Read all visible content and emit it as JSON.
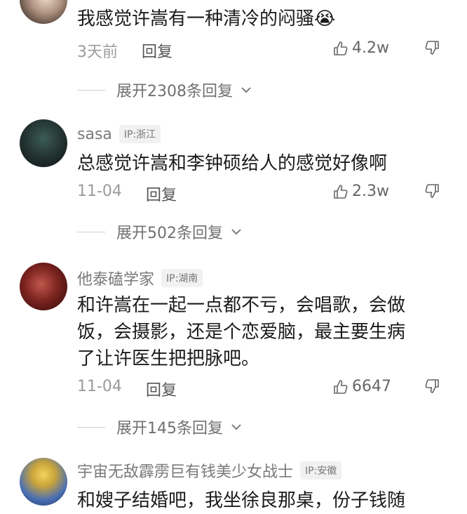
{
  "comments": [
    {
      "text": "我感觉许嵩有一种清冷的闷骚😭",
      "time": "3天前",
      "reply_label": "回复",
      "likes": "4.2w",
      "expand_label": "展开2308条回复"
    },
    {
      "username": "sasa",
      "ip": "IP:浙江",
      "text": "总感觉许嵩和李钟硕给人的感觉好像啊",
      "time": "11-04",
      "reply_label": "回复",
      "likes": "2.3w",
      "expand_label": "展开502条回复"
    },
    {
      "username": "他泰磕学家",
      "ip": "IP:湖南",
      "text_lines": [
        "和许嵩在一起一点都不亏，会唱歌，会做",
        "饭，会摄影，还是个恋爱脑，最主要生病",
        "了让许医生把把脉吧。"
      ],
      "time": "11-04",
      "reply_label": "回复",
      "likes": "6647",
      "expand_label": "展开145条回复"
    },
    {
      "username": "宇宙无敌霹雳巨有钱美少女战士",
      "ip": "IP:安徽",
      "text_partial": "和嫂子结婚吧，我坐徐良那桌，份子钱随"
    }
  ]
}
